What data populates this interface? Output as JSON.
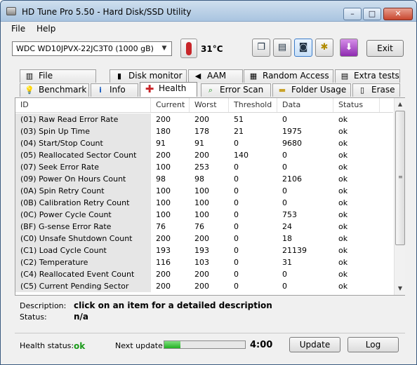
{
  "window": {
    "title": "HD Tune Pro 5.50 - Hard Disk/SSD Utility",
    "minimize": "–",
    "maximize": "□",
    "close": "✕"
  },
  "menu": {
    "file": "File",
    "help": "Help"
  },
  "toolbar": {
    "drive": "WDC WD10JPVX-22JC3T0 (1000 gB)",
    "temperature": "31°C",
    "exit_label": "Exit",
    "icons": [
      "copy-text-icon",
      "copy-info-icon",
      "screenshot-icon",
      "options-icon",
      "save-icon"
    ]
  },
  "tabs_top": [
    {
      "label": "File Benchmark",
      "icon": "file-benchmark-icon"
    },
    {
      "label": "Disk monitor",
      "icon": "disk-monitor-icon"
    },
    {
      "label": "AAM",
      "icon": "speaker-icon"
    },
    {
      "label": "Random Access",
      "icon": "random-access-icon"
    },
    {
      "label": "Extra tests",
      "icon": "extra-tests-icon"
    }
  ],
  "tabs_bottom": [
    {
      "label": "Benchmark",
      "icon": "benchmark-icon"
    },
    {
      "label": "Info",
      "icon": "info-icon"
    },
    {
      "label": "Health",
      "icon": "health-cross-icon"
    },
    {
      "label": "Error Scan",
      "icon": "magnifier-icon"
    },
    {
      "label": "Folder Usage",
      "icon": "folder-icon"
    },
    {
      "label": "Erase",
      "icon": "trash-icon"
    }
  ],
  "active_tab": "Health",
  "table": {
    "columns": [
      "ID",
      "Current",
      "Worst",
      "Threshold",
      "Data",
      "Status"
    ],
    "rows": [
      [
        "(01) Raw Read Error Rate",
        "200",
        "200",
        "51",
        "0",
        "ok"
      ],
      [
        "(03) Spin Up Time",
        "180",
        "178",
        "21",
        "1975",
        "ok"
      ],
      [
        "(04) Start/Stop Count",
        "91",
        "91",
        "0",
        "9680",
        "ok"
      ],
      [
        "(05) Reallocated Sector Count",
        "200",
        "200",
        "140",
        "0",
        "ok"
      ],
      [
        "(07) Seek Error Rate",
        "100",
        "253",
        "0",
        "0",
        "ok"
      ],
      [
        "(09) Power On Hours Count",
        "98",
        "98",
        "0",
        "2106",
        "ok"
      ],
      [
        "(0A) Spin Retry Count",
        "100",
        "100",
        "0",
        "0",
        "ok"
      ],
      [
        "(0B) Calibration Retry Count",
        "100",
        "100",
        "0",
        "0",
        "ok"
      ],
      [
        "(0C) Power Cycle Count",
        "100",
        "100",
        "0",
        "753",
        "ok"
      ],
      [
        "(BF) G-sense Error Rate",
        "76",
        "76",
        "0",
        "24",
        "ok"
      ],
      [
        "(C0) Unsafe Shutdown Count",
        "200",
        "200",
        "0",
        "18",
        "ok"
      ],
      [
        "(C1) Load Cycle Count",
        "193",
        "193",
        "0",
        "21139",
        "ok"
      ],
      [
        "(C2) Temperature",
        "116",
        "103",
        "0",
        "31",
        "ok"
      ],
      [
        "(C4) Reallocated Event Count",
        "200",
        "200",
        "0",
        "0",
        "ok"
      ],
      [
        "(C5) Current Pending Sector",
        "200",
        "200",
        "0",
        "0",
        "ok"
      ]
    ]
  },
  "description": {
    "label": "Description:",
    "value": "click on an item for a detailed description"
  },
  "status": {
    "label": "Status:",
    "value": "n/a"
  },
  "footer": {
    "health_label": "Health status:",
    "health_value": "ok",
    "next_update_label": "Next update:",
    "progress": 0.2,
    "countdown": "4:00",
    "update_label": "Update",
    "log_label": "Log"
  },
  "colors": {
    "ok_green": "#1a9a1a",
    "progress_green": "#22b022",
    "health_red": "#c8262a"
  }
}
